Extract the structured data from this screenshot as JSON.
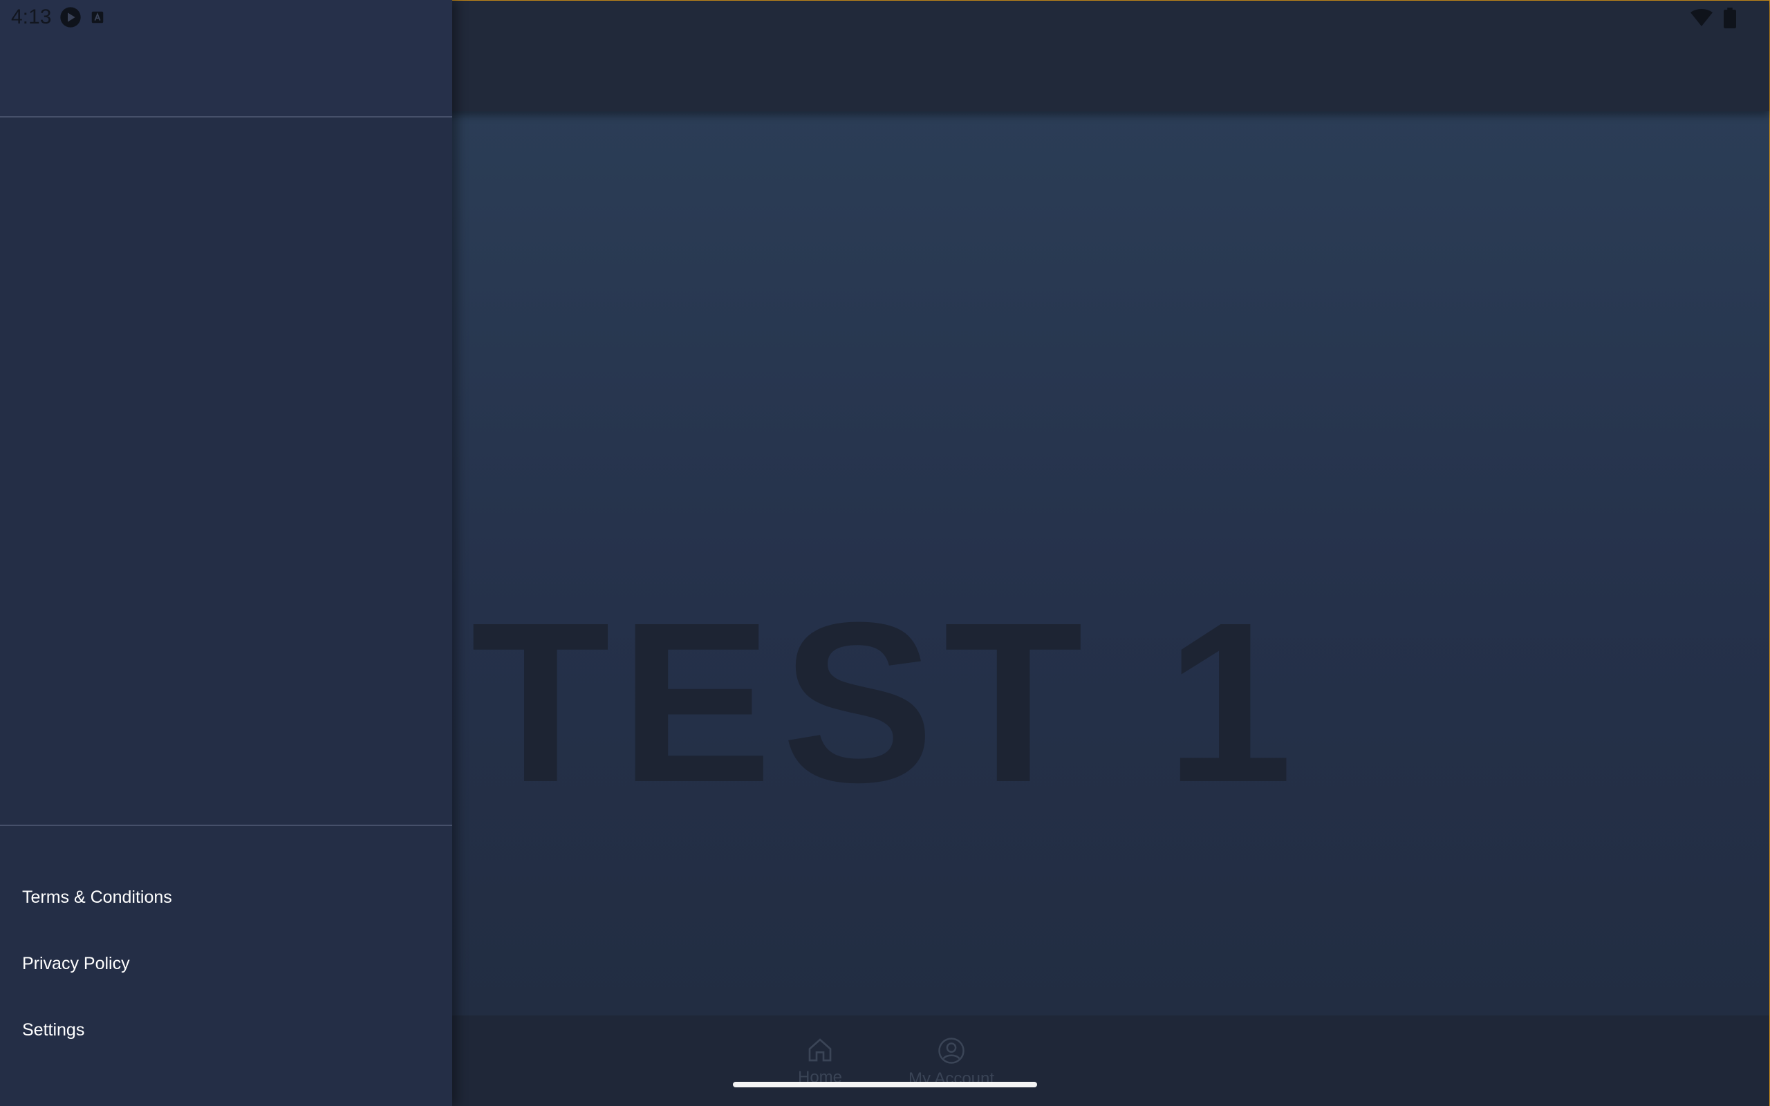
{
  "status_bar": {
    "time": "4:13",
    "left_icons": [
      "media-play-icon",
      "keyboard-icon"
    ],
    "right_icons": [
      "wifi-icon",
      "battery-icon"
    ]
  },
  "drawer": {
    "menu_items": [
      {
        "label": "Terms & Conditions"
      },
      {
        "label": "Privacy Policy"
      },
      {
        "label": "Settings"
      }
    ]
  },
  "main": {
    "hero_text": "TEST 1"
  },
  "bottom_nav": {
    "items": [
      {
        "label": "Home",
        "icon": "home-icon"
      },
      {
        "label": "My Account",
        "icon": "account-icon"
      }
    ]
  },
  "colors": {
    "drawer_bg": "#242e46",
    "app_bg": "#2a3a52",
    "accent_border": "#c68a1a"
  }
}
